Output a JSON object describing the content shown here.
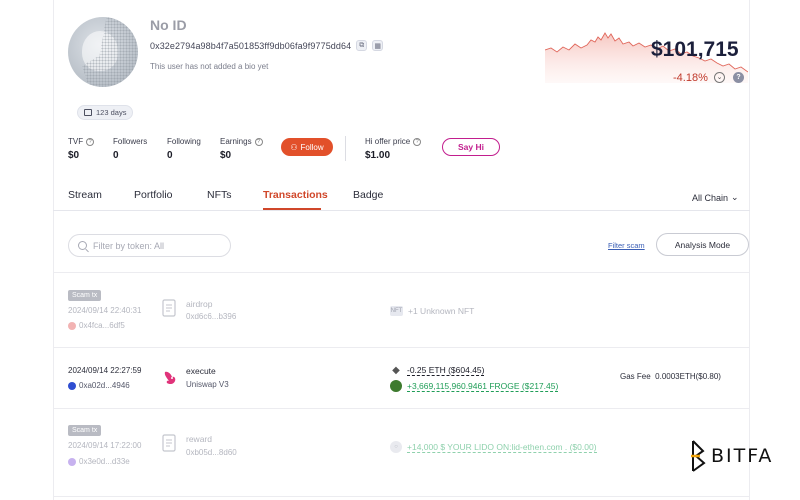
{
  "profile": {
    "name": "No ID",
    "address": "0x32e2794a98b4f7a501853ff9db06fa9f9775dd64",
    "bio": "This user has not added a bio yet",
    "days_badge": "123 days"
  },
  "balance": {
    "value": "$101,715",
    "change": "-4.18%"
  },
  "stats": {
    "tvf": {
      "label": "TVF",
      "value": "$0"
    },
    "followers": {
      "label": "Followers",
      "value": "0"
    },
    "following": {
      "label": "Following",
      "value": "0"
    },
    "earnings": {
      "label": "Earnings",
      "value": "$0"
    },
    "follow_label": "Follow",
    "hi_offer": {
      "label": "Hi offer price",
      "value": "$1.00"
    },
    "say_hi_label": "Say Hi"
  },
  "tabs": [
    {
      "label": "Stream"
    },
    {
      "label": "Portfolio"
    },
    {
      "label": "NFTs"
    },
    {
      "label": "Transactions",
      "active": true
    },
    {
      "label": "Badge"
    }
  ],
  "chain_selector": "All Chain",
  "filters": {
    "token_placeholder": "Filter by token: All",
    "filter_scam": "Filter scam",
    "analysis_mode": "Analysis Mode"
  },
  "transactions": [
    {
      "scam_tag": "Scam tx",
      "time": "2024/09/14 22:40:31",
      "from": "0x4fca...6df5",
      "action": "airdrop",
      "target": "0xd6c6...b396",
      "tokens": [
        {
          "icon": "NFT",
          "amount": "+1 Unknown NFT"
        }
      ]
    },
    {
      "time": "2024/09/14 22:27:59",
      "from": "0xa02d...4946",
      "action": "execute",
      "target": "Uniswap V3",
      "tokens": [
        {
          "icon": "eth-icon",
          "amount": "-0.25 ETH ($604.45)"
        },
        {
          "icon": "froge-icon",
          "amount": "+3,669,115,960.9461 FROGE ($217.45)"
        }
      ],
      "gas_fee_label": "Gas Fee",
      "gas_fee_value": "0.0003ETH($0.80)"
    },
    {
      "scam_tag": "Scam tx",
      "time": "2024/09/14 17:22:00",
      "from": "0x3e0d...d33e",
      "action": "reward",
      "target": "0xb05d...8d60",
      "tokens": [
        {
          "icon": "lido-icon",
          "amount": "+14,000 $ YOUR LIDO ON:lid-ethen.com . ($0.00)"
        }
      ]
    }
  ],
  "brand": {
    "name": "BITFA"
  },
  "colors": {
    "accent": "#d0472a",
    "say_hi": "#c21e8e",
    "negative": "#c0392b",
    "positive": "#1f9d57",
    "balance": "#1b1f3b"
  }
}
